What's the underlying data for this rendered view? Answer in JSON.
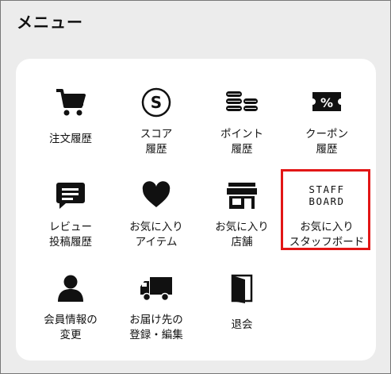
{
  "menu": {
    "title": "メニュー",
    "items": [
      {
        "lines": [
          "注文履歴"
        ],
        "icon": "cart-icon"
      },
      {
        "lines": [
          "スコア",
          "履歴"
        ],
        "icon": "score-s-icon"
      },
      {
        "lines": [
          "ポイント",
          "履歴"
        ],
        "icon": "coins-icon"
      },
      {
        "lines": [
          "クーポン",
          "履歴"
        ],
        "icon": "coupon-icon"
      },
      {
        "lines": [
          "レビュー",
          "投稿履歴"
        ],
        "icon": "speech-bubble-icon"
      },
      {
        "lines": [
          "お気に入り",
          "アイテム"
        ],
        "icon": "heart-icon"
      },
      {
        "lines": [
          "お気に入り",
          "店舗"
        ],
        "icon": "store-icon"
      },
      {
        "lines": [
          "お気に入り",
          "スタッフボード"
        ],
        "icon": "staff-board-logo"
      },
      {
        "lines": [
          "会員情報の",
          "変更"
        ],
        "icon": "person-icon"
      },
      {
        "lines": [
          "お届け先の",
          "登録・編集"
        ],
        "icon": "truck-icon"
      },
      {
        "lines": [
          "退会"
        ],
        "icon": "exit-door-icon"
      }
    ],
    "staff_logo": {
      "line1": "STAFF",
      "line2": "BOARD"
    },
    "highlight_color": "#e21616"
  }
}
